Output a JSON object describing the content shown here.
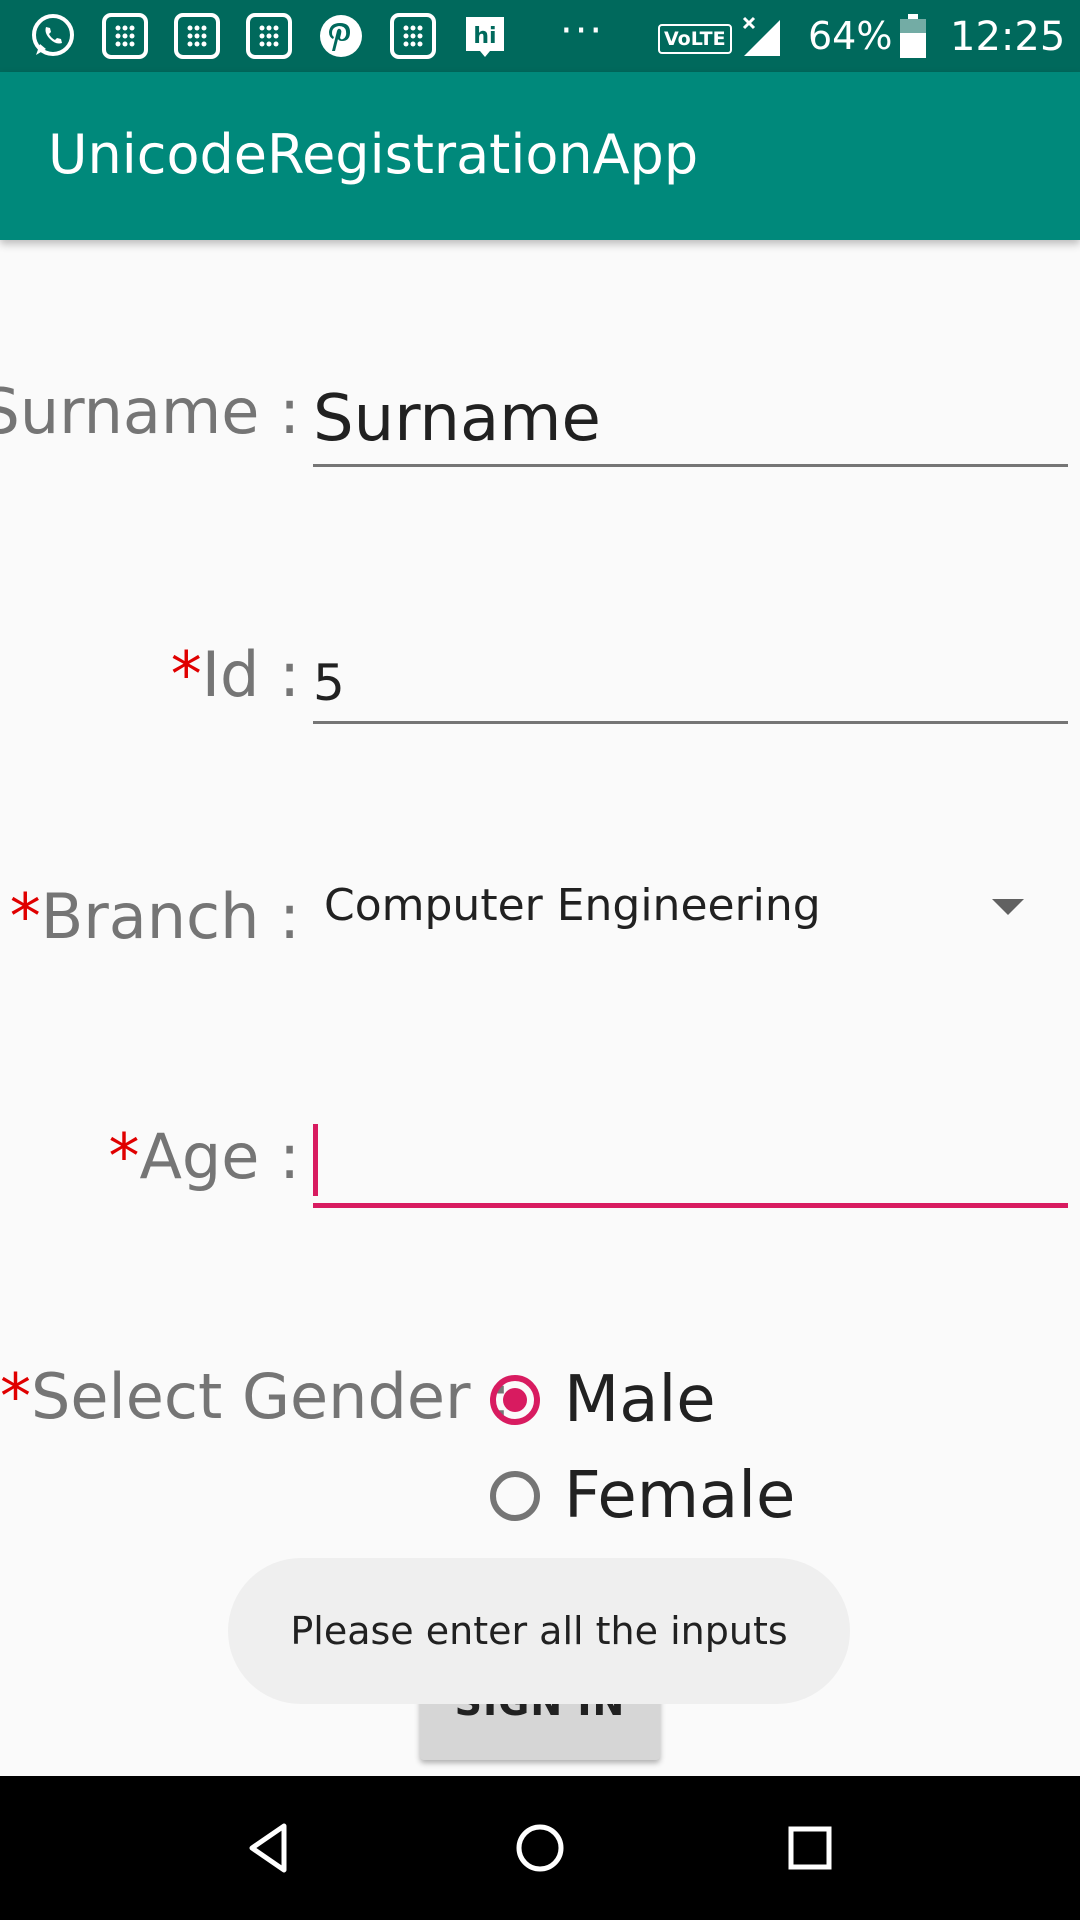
{
  "status_bar": {
    "icons": [
      "whatsapp-icon",
      "calendar-icon",
      "calendar-icon",
      "calendar-icon",
      "pinterest-icon",
      "calendar-icon",
      "hike-icon"
    ],
    "overflow": "···",
    "volte": "VoLTE",
    "battery_percent": "64%",
    "time": "12:25"
  },
  "app_bar": {
    "title": "UnicodeRegistrationApp"
  },
  "form": {
    "required_mark": "*",
    "surname": {
      "label": "Surname :",
      "value": "Surname"
    },
    "id": {
      "label": "Id :",
      "value": "5"
    },
    "branch": {
      "label": "Branch :",
      "value": "Computer Engineering"
    },
    "age": {
      "label": "Age :",
      "value": ""
    },
    "gender": {
      "label": "Select Gender :",
      "options": [
        {
          "label": "Male",
          "checked": true
        },
        {
          "label": "Female",
          "checked": false
        }
      ]
    },
    "sign_in_label": "SIGN IN"
  },
  "toast": {
    "message": "Please enter all the inputs"
  },
  "colors": {
    "primary": "#00897b",
    "primary_dark": "#00695c",
    "accent": "#d81b60",
    "required": "#e00000"
  }
}
